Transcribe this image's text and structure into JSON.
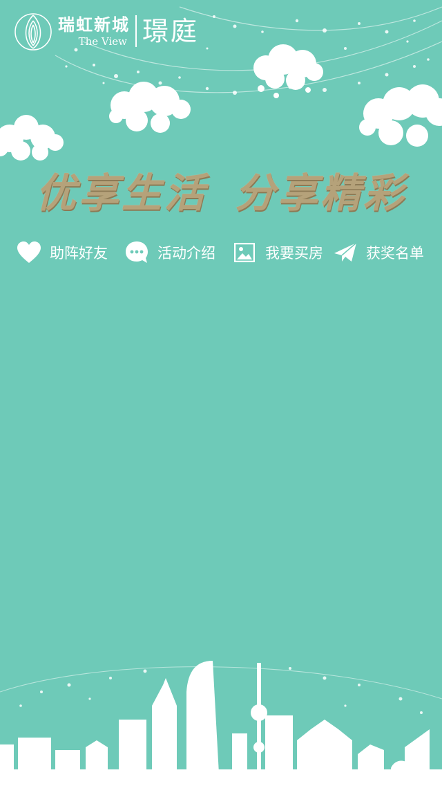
{
  "brand": {
    "name_cn": "瑞虹新城",
    "name_en": "The View",
    "sub_name": "璟庭"
  },
  "slogan": "优享生活 分享精彩",
  "nav": [
    {
      "label": "助阵好友",
      "icon": "heart-icon"
    },
    {
      "label": "活动介绍",
      "icon": "chat-bubble-icon"
    },
    {
      "label": "我要买房",
      "icon": "image-icon"
    },
    {
      "label": "获奖名单",
      "icon": "paper-plane-icon"
    }
  ],
  "colors": {
    "background": "#6ecab8",
    "slogan_gold": "#b5a27a",
    "foreground": "#ffffff"
  }
}
